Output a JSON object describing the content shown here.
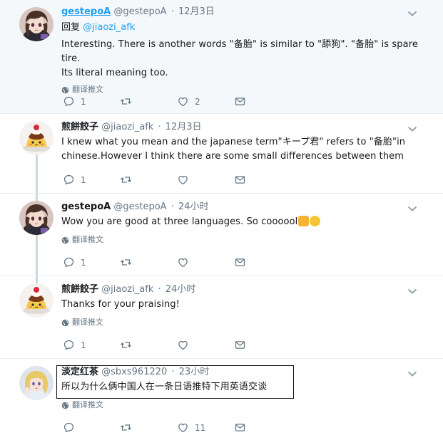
{
  "tweets": [
    {
      "name": "gestepoA",
      "handle": "@gestepoA",
      "dot": "·",
      "time": "12月3日",
      "reply_label": "回复",
      "reply_mention": "@jiaozi_afk",
      "text_line1": "Interesting. There is another words \"备胎\" is similar to \"舔狗\". \"备胎\" is spare tire.",
      "text_line2": "Its literal meaning too.",
      "translate": "翻译推文",
      "reply_count": "1",
      "retweet_count": "",
      "like_count": "2"
    },
    {
      "name": "煎餅餃子",
      "handle": "@jiaozi_afk",
      "dot": "·",
      "time": "12月3日",
      "text_line1": "I knew what you mean and the japanese term\"キープ君\" refers to \"备胎\"in",
      "text_line2": "chinese.However I think there are some small differences between them",
      "reply_count": "1",
      "retweet_count": "",
      "like_count": ""
    },
    {
      "name": "gestepoA",
      "handle": "@gestepoA",
      "dot": "·",
      "time": "24小时",
      "text_line1": "Wow you are good at three languages. So coooool",
      "translate": "翻译推文",
      "reply_count": "1",
      "retweet_count": "",
      "like_count": ""
    },
    {
      "name": "煎餅餃子",
      "handle": "@jiaozi_afk",
      "dot": "·",
      "time": "24小时",
      "text_line1": "Thanks for your praising!",
      "translate": "翻译推文",
      "reply_count": "1",
      "retweet_count": "",
      "like_count": ""
    },
    {
      "name": "淡定红茶",
      "handle": "@sbxs961220",
      "dot": "·",
      "time": "23小时",
      "text_line1": "所以为什么俩中国人在一条日语推特下用英语交谈",
      "translate": "翻译推文",
      "reply_count": "",
      "retweet_count": "",
      "like_count": "11"
    }
  ],
  "icons": {
    "reply": "reply-icon",
    "retweet": "retweet-icon",
    "like": "heart-icon",
    "message": "envelope-icon",
    "caret": "chevron-down-icon",
    "globe": "globe-icon",
    "emoji1": "thumbs-up-emoji",
    "emoji2": "grinning-face-emoji"
  },
  "colors": {
    "link": "#1da1f2",
    "muted": "#657786",
    "thread_line": "#ccd6dd",
    "highlight_bg": "#f5f8fa"
  }
}
